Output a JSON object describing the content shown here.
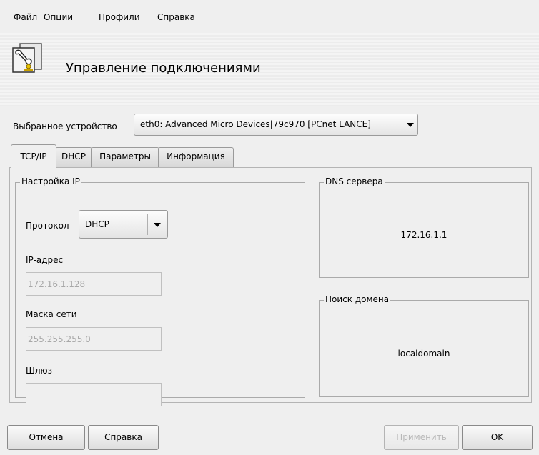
{
  "menu": {
    "file": {
      "accel": "Ф",
      "rest": "айл"
    },
    "options": {
      "accel": "О",
      "rest": "пции"
    },
    "profiles": {
      "accel": "П",
      "rest": "рофили"
    },
    "help": {
      "accel": "С",
      "rest": "правка"
    }
  },
  "header": {
    "title": "Управление подключениями",
    "icon": "network-tools-icon"
  },
  "device": {
    "label": "Выбранное устройство",
    "value": "eth0: Advanced Micro Devices|79c970 [PCnet LANCE]"
  },
  "tabs": [
    {
      "label": "TCP/IP",
      "active": true
    },
    {
      "label": "DHCP",
      "active": false
    },
    {
      "label": "Параметры",
      "active": false
    },
    {
      "label": "Информация",
      "active": false
    }
  ],
  "ip_settings": {
    "title": "Настройка IP",
    "protocol_label": "Протокол",
    "protocol_value": "DHCP",
    "ip_label": "IP-адрес",
    "ip_value": "172.16.1.128",
    "mask_label": "Маска сети",
    "mask_value": "255.255.255.0",
    "gateway_label": "Шлюз",
    "gateway_value": ""
  },
  "dns": {
    "title": "DNS сервера",
    "value": "172.16.1.1"
  },
  "domain_search": {
    "title": "Поиск домена",
    "value": "localdomain"
  },
  "buttons": {
    "cancel": "Отмена",
    "help": "Справка",
    "apply": "Применить",
    "ok": "OK"
  }
}
